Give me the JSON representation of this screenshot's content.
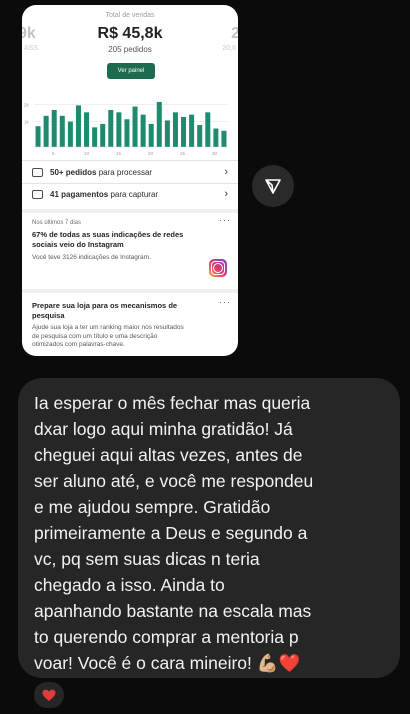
{
  "story": {
    "left_prev_value": "9k",
    "left_prev_sub": "ASS",
    "total_label": "Total de vendas",
    "total_value": "R$ 45,8k",
    "orders": "205 pedidos",
    "panel_button": "Ver painel",
    "right_next_value": "2",
    "right_next_sub": "20,6",
    "chart_data": {
      "type": "bar",
      "x": [
        1,
        2,
        3,
        4,
        5,
        6,
        7,
        8,
        9,
        10,
        11,
        12,
        13,
        14,
        15,
        16,
        17,
        18,
        19,
        20,
        21,
        22,
        23,
        24
      ],
      "values": [
        18,
        27,
        32,
        27,
        22,
        36,
        30,
        17,
        20,
        32,
        30,
        24,
        35,
        28,
        20,
        39,
        23,
        30,
        26,
        28,
        19,
        30,
        16,
        14
      ],
      "x_ticks": [
        "5",
        "10",
        "15",
        "20",
        "25",
        "30"
      ],
      "y_ticks": [
        "2k",
        "1k"
      ],
      "ylim": [
        0,
        45
      ],
      "color": "#1f8a70"
    },
    "orders_row": {
      "bold": "50+ pedidos",
      "rest": " para processar"
    },
    "payments_row": {
      "bold": "41 pagamentos",
      "rest": " para capturar"
    },
    "insight": {
      "period": "Nos últimos 7 dias",
      "title": "67% de todas as suas indicações de redes sociais veio do Instagram",
      "detail": "Você teve 3126 indicações de Instagram."
    },
    "seo": {
      "title": "Prepare sua loja para os mecanismos de pesquisa",
      "detail_lines": [
        "Ajude sua loja a ter um ranking maior nos resultados",
        "de pesquisa com um título e uma descrição",
        "otimizados com palavras-chave."
      ]
    }
  },
  "message": {
    "lines": [
      "Ia esperar o mês fechar mas queria",
      "dxar logo aqui minha gratidão! Já",
      "cheguei aqui altas vezes, antes de",
      "ser aluno até, e você me respondeu",
      "e me ajudou sempre. Gratidão",
      "primeiramente a Deus e segundo a",
      "vc, pq sem suas dicas n teria",
      "chegado a isso. Ainda to",
      "apanhando bastante na escala mas",
      "to querendo comprar a mentoria p",
      "voar! Você é o cara mineiro! 💪🏼❤️"
    ]
  },
  "icons": {
    "share": "share-icon",
    "heart_reaction": "heart-icon",
    "instagram": "instagram-icon"
  },
  "colors": {
    "background": "#0b0b0b",
    "bubble": "#262626",
    "accent_green": "#1c6b4f",
    "heart": "#e0393e"
  }
}
